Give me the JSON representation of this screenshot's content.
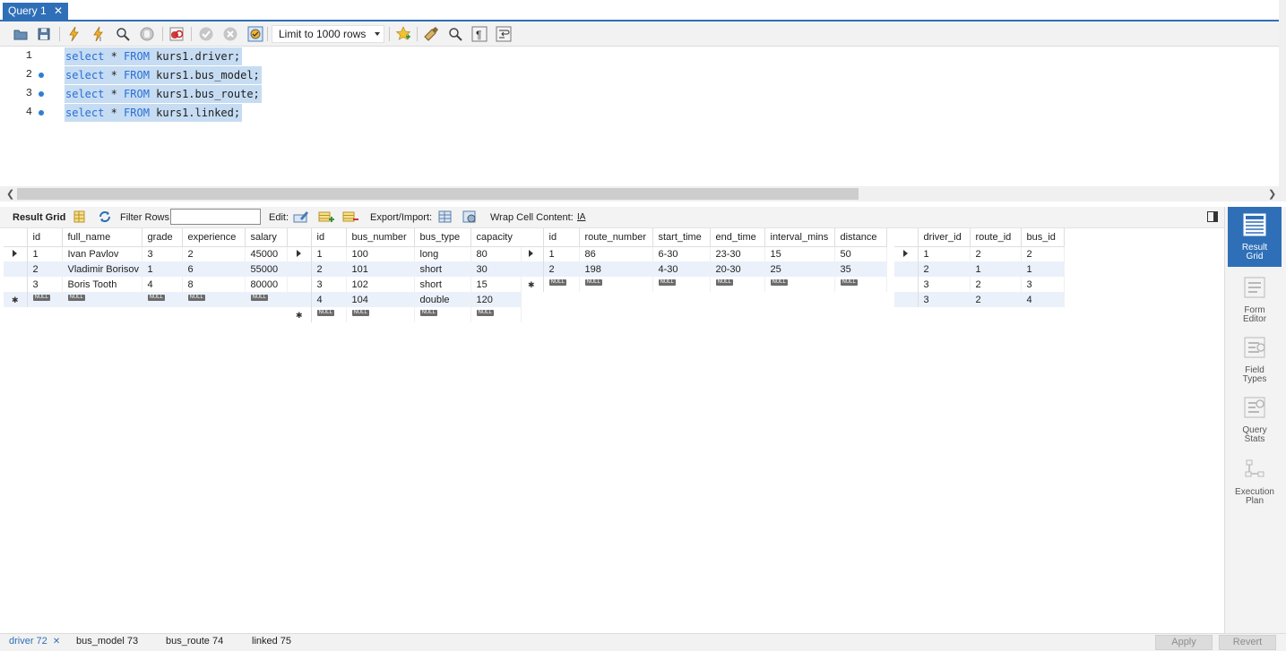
{
  "query_tab": {
    "title": "Query 1",
    "close": "✕"
  },
  "toolbar": {
    "limit": "Limit to 1000 rows"
  },
  "editor": {
    "lines": [
      {
        "num": "1",
        "kw1": "select",
        "star": " * ",
        "kw2": "FROM",
        "rest": " kurs1.driver;"
      },
      {
        "num": "2",
        "kw1": "select",
        "star": " * ",
        "kw2": "FROM",
        "rest": " kurs1.bus_model;"
      },
      {
        "num": "3",
        "kw1": "select",
        "star": " * ",
        "kw2": "FROM",
        "rest": " kurs1.bus_route;"
      },
      {
        "num": "4",
        "kw1": "select",
        "star": " * ",
        "kw2": "FROM",
        "rest": " kurs1.linked;"
      }
    ]
  },
  "result_toolbar": {
    "result_grid": "Result Grid",
    "filter_rows": "Filter Rows:",
    "edit": "Edit:",
    "export_import": "Export/Import:",
    "wrap": "Wrap Cell Content:",
    "wrap_icon": "IA"
  },
  "null_label": "NULL",
  "grids": {
    "driver": {
      "columns": [
        "id",
        "full_name",
        "grade",
        "experience",
        "salary"
      ],
      "rows": [
        [
          "1",
          "Ivan Pavlov",
          "3",
          "2",
          "45000"
        ],
        [
          "2",
          "Vladimir Borisov",
          "1",
          "6",
          "55000"
        ],
        [
          "3",
          "Boris Tooth",
          "4",
          "8",
          "80000"
        ]
      ]
    },
    "bus_model": {
      "columns": [
        "id",
        "bus_number",
        "bus_type",
        "capacity"
      ],
      "rows": [
        [
          "1",
          "100",
          "long",
          "80"
        ],
        [
          "2",
          "101",
          "short",
          "30"
        ],
        [
          "3",
          "102",
          "short",
          "15"
        ],
        [
          "4",
          "104",
          "double",
          "120"
        ]
      ]
    },
    "bus_route": {
      "columns": [
        "id",
        "route_number",
        "start_time",
        "end_time",
        "interval_mins",
        "distance"
      ],
      "rows": [
        [
          "1",
          "86",
          "6-30",
          "23-30",
          "15",
          "50"
        ],
        [
          "2",
          "198",
          "4-30",
          "20-30",
          "25",
          "35"
        ]
      ]
    },
    "linked": {
      "columns": [
        "driver_id",
        "route_id",
        "bus_id"
      ],
      "rows": [
        [
          "1",
          "2",
          "2"
        ],
        [
          "2",
          "1",
          "1"
        ],
        [
          "3",
          "2",
          "3"
        ],
        [
          "3",
          "2",
          "4"
        ]
      ]
    }
  },
  "sidebar": {
    "result_grid": "Result Grid",
    "form_editor": "Form Editor",
    "field_types": "Field Types",
    "query_stats": "Query Stats",
    "execution_plan": "Execution Plan"
  },
  "bottom_tabs": {
    "t1": "driver 72",
    "t2": "bus_model 73",
    "t3": "bus_route 74",
    "t4": "linked 75",
    "close": "✕",
    "apply": "Apply",
    "revert": "Revert"
  },
  "colors": {
    "accent": "#2f6fb8",
    "selection": "#c6dcf2",
    "keyword": "#2a6fd6",
    "alt_row": "#eaf1fb"
  }
}
